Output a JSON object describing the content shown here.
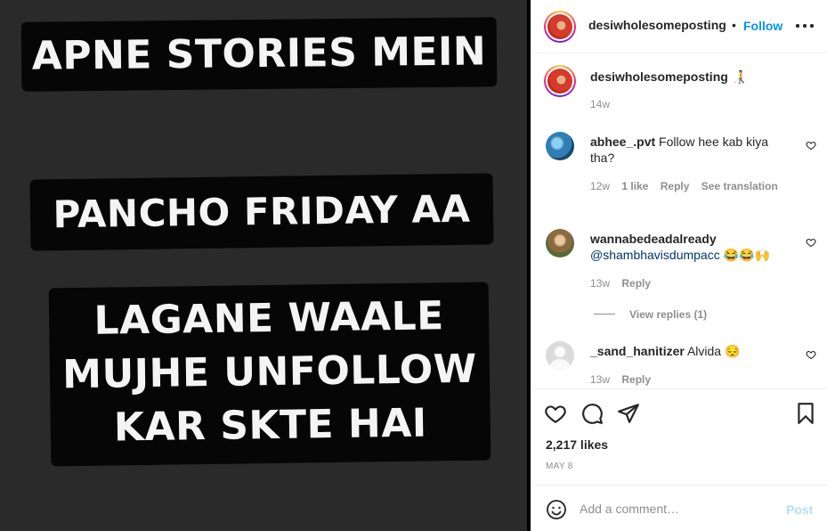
{
  "post": {
    "caption_lines": {
      "line1": "APNE STORIES MEIN",
      "line2": "PANCHO FRIDAY AA",
      "line3a": "LAGANE WAALE",
      "line3b": "MUJHE UNFOLLOW",
      "line3c": "KAR SKTE HAI"
    }
  },
  "header": {
    "username": "desiwholesomeposting",
    "separator": "•",
    "follow_label": "Follow",
    "more_icon": "more-horizontal-icon"
  },
  "caption": {
    "username": "desiwholesomeposting",
    "text": "🧑‍🦯",
    "age": "14w"
  },
  "comments": [
    {
      "username": "abhee_.pvt",
      "text": "Follow hee kab kiya tha?",
      "text_line1": "Follow hee kab kiya",
      "text_line2": "tha?",
      "age": "12w",
      "likes": "1 like",
      "reply": "Reply",
      "translate": "See translation"
    },
    {
      "username": "wannabedeadalready",
      "mention": "@shambhavisdumpacc",
      "text": "😂😂🙌",
      "age": "13w",
      "reply": "Reply",
      "view_replies": "View replies (1)"
    },
    {
      "username": "_sand_hanitizer",
      "text": "Alvida 😔",
      "age": "13w",
      "reply": "Reply"
    }
  ],
  "actions": {
    "likes": "2,217 likes",
    "date": "MAY 8"
  },
  "composer": {
    "placeholder": "Add a comment…",
    "post_label": "Post"
  },
  "colors": {
    "accent": "#0095f6",
    "post_disabled": "#b2dffc",
    "meta": "#8e8e8e",
    "text": "#262626"
  }
}
